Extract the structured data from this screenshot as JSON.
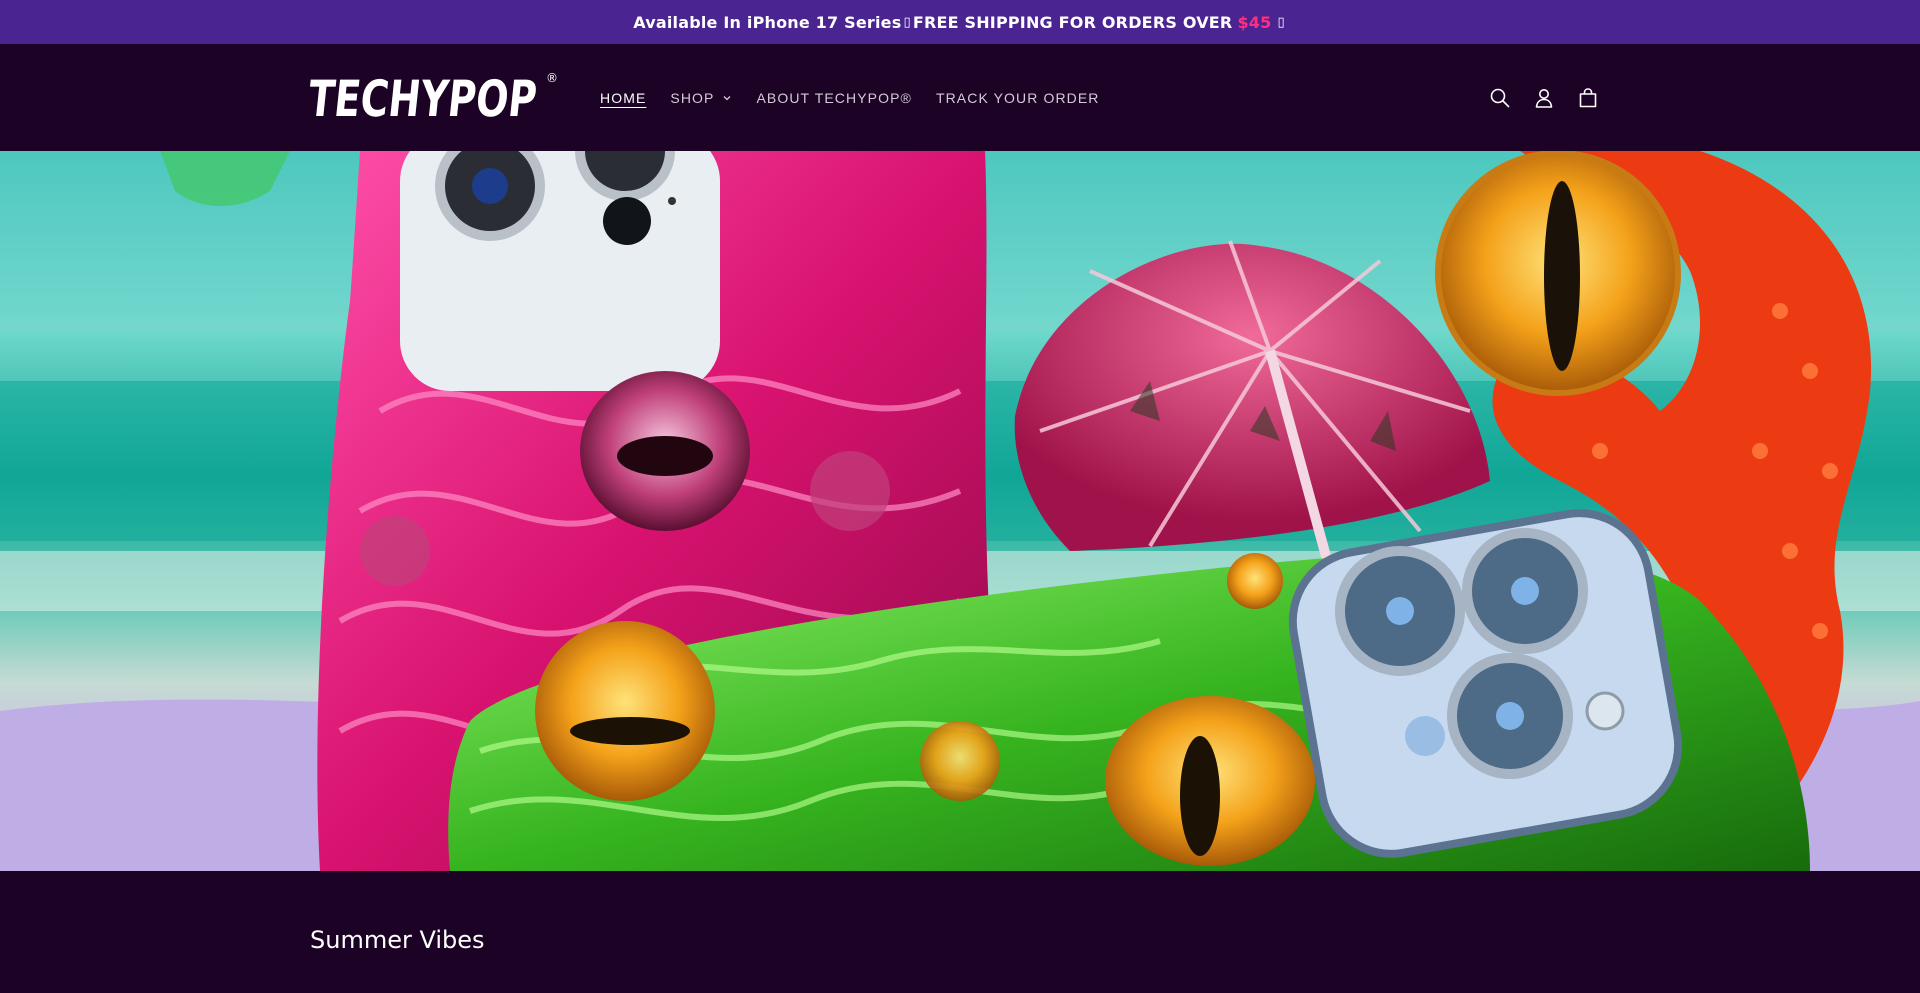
{
  "announcement": {
    "text": "Available In iPhone 17 Series",
    "glyph": "▯",
    "text2": "FREE SHIPPING FOR ORDERS OVER",
    "price": "$45",
    "end_glyph": "▯"
  },
  "header": {
    "logo_text": "TECHYPOP",
    "logo_mark": "®",
    "nav": [
      {
        "label": "HOME"
      },
      {
        "label": "SHOP"
      },
      {
        "label": "ABOUT TECHYPOP®"
      },
      {
        "label": "TRACK YOUR ORDER"
      }
    ],
    "icons": [
      "search-icon",
      "account-icon",
      "cart-icon"
    ]
  },
  "hero": {
    "image_label": "hero-banner"
  },
  "section": {
    "title": "Summer Vibes"
  },
  "colors": {
    "announcement_bg": "#4a2490",
    "header_bg": "#1c0225",
    "price_accent": "#ff2e80"
  }
}
